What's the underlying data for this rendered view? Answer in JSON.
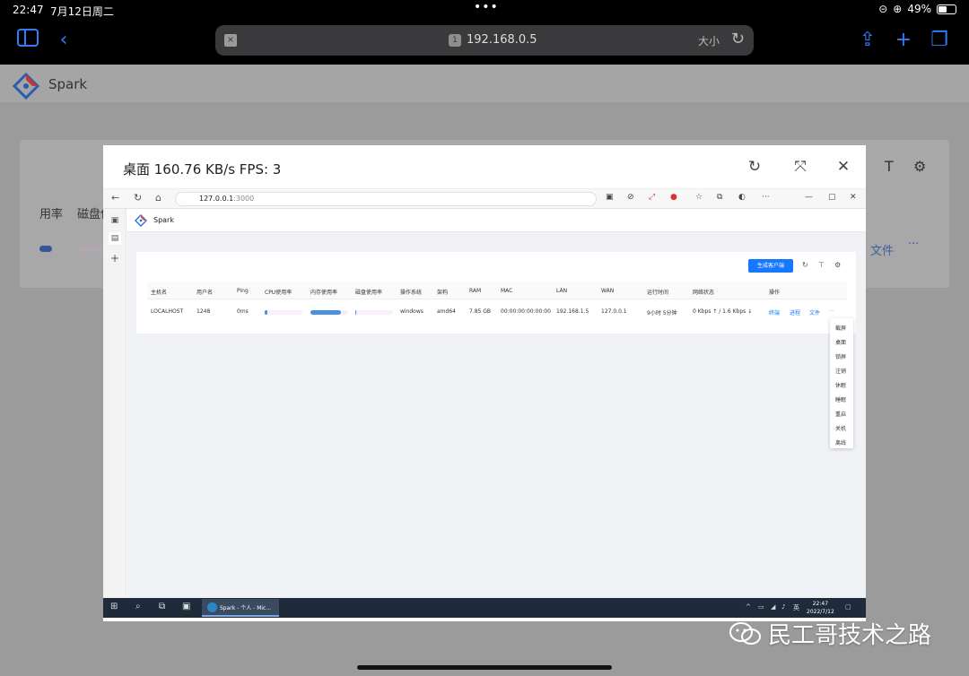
{
  "ipad": {
    "time": "22:47",
    "date": "7月12日周二",
    "dots": "•••",
    "battery": "49%",
    "battery_level": 0.49,
    "url": "192.168.0.5",
    "tab_badge": "1",
    "text_size": "大小",
    "close_mark": "×",
    "icons": {
      "sidebar": "sidebar-icon",
      "back": "‹",
      "share": "⇪",
      "plus": "+",
      "tabs": "❐",
      "reload": "↻"
    }
  },
  "background": {
    "brand": "Spark",
    "col1": "用率",
    "col2": "磁盘使",
    "file": "文件",
    "more": "···"
  },
  "modal": {
    "title": "桌面 160.76 KB/s FPS: 3",
    "reload_icon": "↻",
    "fullscreen_icon": "⤧",
    "close_icon": "✕"
  },
  "edge": {
    "url_host": "127.0.0.1",
    "url_port": ":3000",
    "nav_back": "←",
    "nav_reload": "↻",
    "nav_home": "⌂",
    "win_min": "—",
    "win_max": "▢",
    "win_close": "✕"
  },
  "app": {
    "brand": "Spark",
    "generate_button": "生成客户端",
    "headers": [
      "主机名",
      "用户名",
      "Ping",
      "CPU使用率",
      "内存使用率",
      "磁盘使用率",
      "操作系统",
      "架构",
      "RAM",
      "MAC",
      "LAN",
      "WAN",
      "运行时间",
      "网络状态",
      "操作"
    ],
    "row": {
      "hostname": "LOCALHOST",
      "username": "1248",
      "ping": "0ms",
      "cpu": 0.08,
      "mem": 0.82,
      "disk": 0.02,
      "os": "windows",
      "arch": "amd64",
      "ram": "7.85 GB",
      "mac": "00:00:00:00:00:00",
      "lan": "192.168.1.5",
      "wan": "127.0.0.1",
      "uptime": "9小时 5分钟",
      "network": "0 Kbps ↑ / 1.6 Kbps ↓",
      "actions": [
        "终端",
        "进程",
        "文件",
        "···"
      ]
    },
    "menu": [
      "截屏",
      "桌面",
      "锁屏",
      "注销",
      "休眠",
      "睡眠",
      "重启",
      "关机",
      "离线"
    ]
  },
  "taskbar": {
    "app_label": "Spark - 个人 - Mic...",
    "ime": "英",
    "time": "22:47",
    "date": "2022/7/12"
  },
  "watermark": "民工哥技术之路"
}
